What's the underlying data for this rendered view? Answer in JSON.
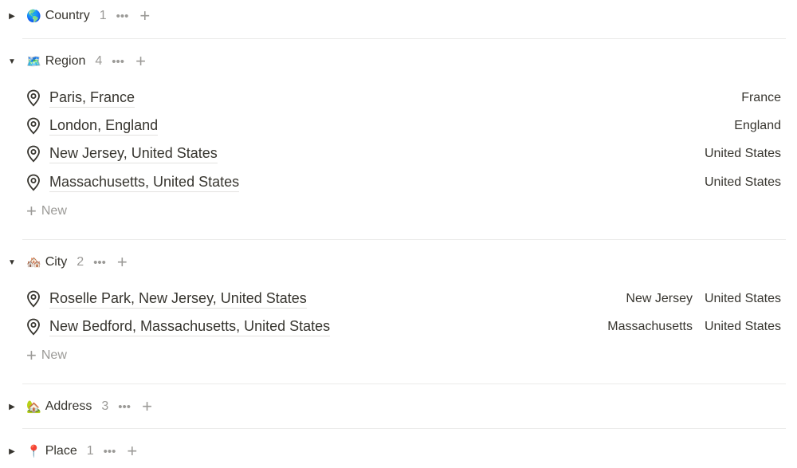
{
  "groups": {
    "country": {
      "emoji": "🌎",
      "label": "Country",
      "count": "1",
      "dots": "•••",
      "plus": "+",
      "toggle": "▶"
    },
    "region": {
      "emoji": "🗺️",
      "label": "Region",
      "count": "4",
      "dots": "•••",
      "plus": "+",
      "toggle": "▼",
      "rows": [
        {
          "title": "Paris, France",
          "col1": "",
          "col2": "France"
        },
        {
          "title": "London, England",
          "col1": "",
          "col2": "England"
        },
        {
          "title": "New Jersey, United States",
          "col1": "",
          "col2": "United States"
        },
        {
          "title": "Massachusetts, United States",
          "col1": "",
          "col2": "United States"
        }
      ],
      "new_label": "New"
    },
    "city": {
      "emoji": "🏘️",
      "label": "City",
      "count": "2",
      "dots": "•••",
      "plus": "+",
      "toggle": "▼",
      "rows": [
        {
          "title": "Roselle Park, New Jersey, United States",
          "col1": "New Jersey",
          "col2": "United States"
        },
        {
          "title": "New Bedford, Massachusetts, United States",
          "col1": "Massachusetts",
          "col2": "United States"
        }
      ],
      "new_label": "New"
    },
    "address": {
      "emoji": "🏡",
      "label": "Address",
      "count": "3",
      "dots": "•••",
      "plus": "+",
      "toggle": "▶"
    },
    "place": {
      "emoji": "📍",
      "label": "Place",
      "count": "1",
      "dots": "•••",
      "plus": "+",
      "toggle": "▶"
    }
  },
  "icons": {
    "row_icon": "location-pin-icon"
  }
}
